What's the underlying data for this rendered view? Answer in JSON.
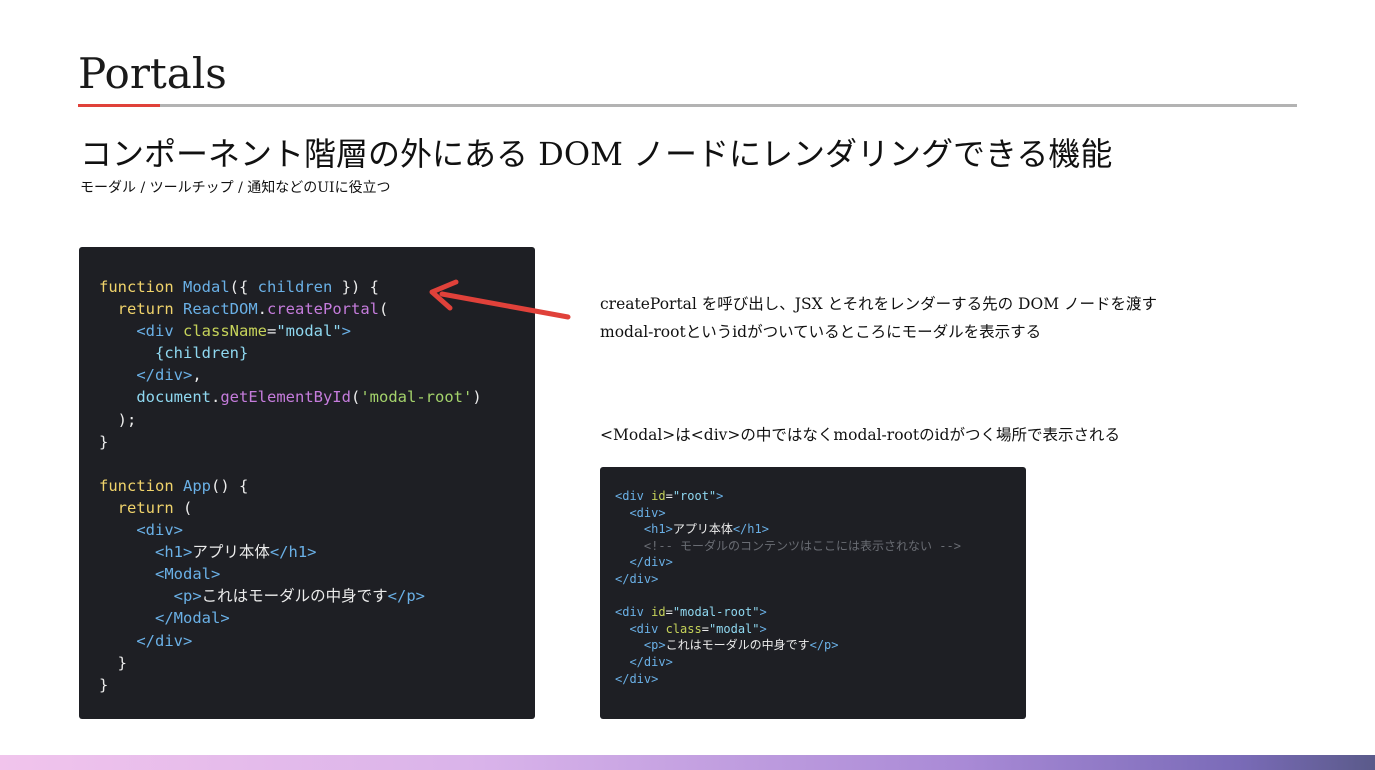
{
  "slide": {
    "title": "Portals",
    "subtitle": "コンポーネント階層の外にある DOM ノードにレンダリングできる機能",
    "caption": "モーダル / ツールチップ / 通知などのUIに役立つ"
  },
  "notes": {
    "line1": "createPortal を呼び出し、JSX とそれをレンダーする先の DOM ノードを渡す",
    "line2": "modal-rootというidがついているところにモーダルを表示する",
    "line3": "<Modal>は<div>の中ではなくmodal-rootのidがつく場所で表示される"
  },
  "code_main": {
    "t1_kw": "function",
    "t1_fn": "Modal",
    "t1_a": "({ ",
    "t1_b": "children",
    "t1_c": " }) {",
    "t2_kw": "return",
    "t2_obj": "ReactDOM",
    "t2_dot": ".",
    "t2_call": "createPortal",
    "t2_p": "(",
    "t3_tag": "<div",
    "t3_attr": "className",
    "t3_eq": "=",
    "t3_str": "\"modal\"",
    "t3_close": ">",
    "t4": "{children}",
    "t5": "</div>",
    "t5_c": ",",
    "t6_obj": "document",
    "t6_dot": ".",
    "t6_call": "getElementById",
    "t6_p": "(",
    "t6_str": "'modal-root'",
    "t6_pc": ")",
    "t7": ");",
    "t8": "}",
    "t10_kw": "function",
    "t10_fn": "App",
    "t10_a": "() {",
    "t11_kw": "return",
    "t11_a": " (",
    "t12": "<div>",
    "t13_o": "<h1>",
    "t13_t": "アプリ本体",
    "t13_c": "</h1>",
    "t14": "<Modal>",
    "t15_o": "<p>",
    "t15_t": "これはモーダルの中身です",
    "t15_c": "</p>",
    "t16": "</Modal>",
    "t17": "</div>",
    "t18": "}",
    "t19": "}"
  },
  "code_small": {
    "s1_o": "<div ",
    "s1_attr": "id",
    "s1_eq": "=",
    "s1_str": "\"root\"",
    "s1_c": ">",
    "s2": "<div>",
    "s3_o": "<h1>",
    "s3_t": "アプリ本体",
    "s3_c": "</h1>",
    "s4": "<!-- モーダルのコンテンツはここには表示されない -->",
    "s5": "</div>",
    "s6": "</div>",
    "s8_o": "<div ",
    "s8_attr": "id",
    "s8_eq": "=",
    "s8_str": "\"modal-root\"",
    "s8_c": ">",
    "s9_o": "<div ",
    "s9_attr": "class",
    "s9_eq": "=",
    "s9_str": "\"modal\"",
    "s9_c": ">",
    "s10_o": "<p>",
    "s10_t": "これはモーダルの中身です",
    "s10_c": "</p>",
    "s11": "</div>",
    "s12": "</div>"
  },
  "colors": {
    "accent_red": "#e0413a",
    "code_bg": "#1e1f24",
    "rule_gray": "#b3b3b3"
  }
}
